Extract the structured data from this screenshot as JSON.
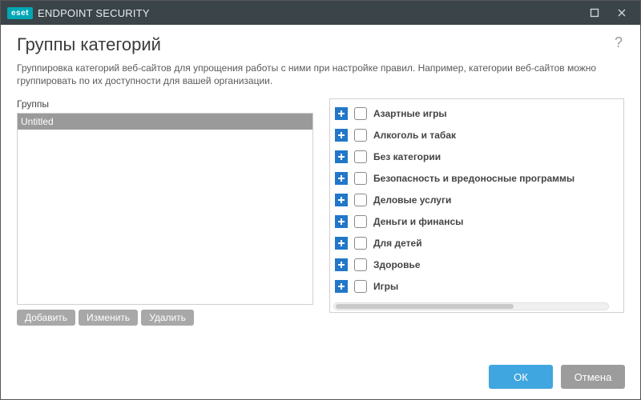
{
  "titlebar": {
    "brand_badge": "eset",
    "brand_text": "ENDPOINT SECURITY"
  },
  "page": {
    "heading": "Группы категорий",
    "help_tooltip": "?",
    "description": "Группировка категорий веб-сайтов для упрощения работы с ними при настройке правил. Например, категории веб-сайтов можно группировать по их доступности для вашей организации."
  },
  "groups": {
    "label": "Группы",
    "items": [
      {
        "name": "Untitled",
        "selected": true
      }
    ],
    "actions": {
      "add": "Добавить",
      "edit": "Изменить",
      "delete": "Удалить"
    }
  },
  "categories": {
    "items": [
      {
        "label": "Азартные игры",
        "checked": false
      },
      {
        "label": "Алкоголь и табак",
        "checked": false
      },
      {
        "label": "Без категории",
        "checked": false
      },
      {
        "label": "Безопасность и вредоносные программы",
        "checked": false
      },
      {
        "label": "Деловые услуги",
        "checked": false
      },
      {
        "label": "Деньги и финансы",
        "checked": false
      },
      {
        "label": "Для детей",
        "checked": false
      },
      {
        "label": "Здоровье",
        "checked": false
      },
      {
        "label": "Игры",
        "checked": false
      }
    ]
  },
  "footer": {
    "ok": "ОК",
    "cancel": "Отмена"
  }
}
